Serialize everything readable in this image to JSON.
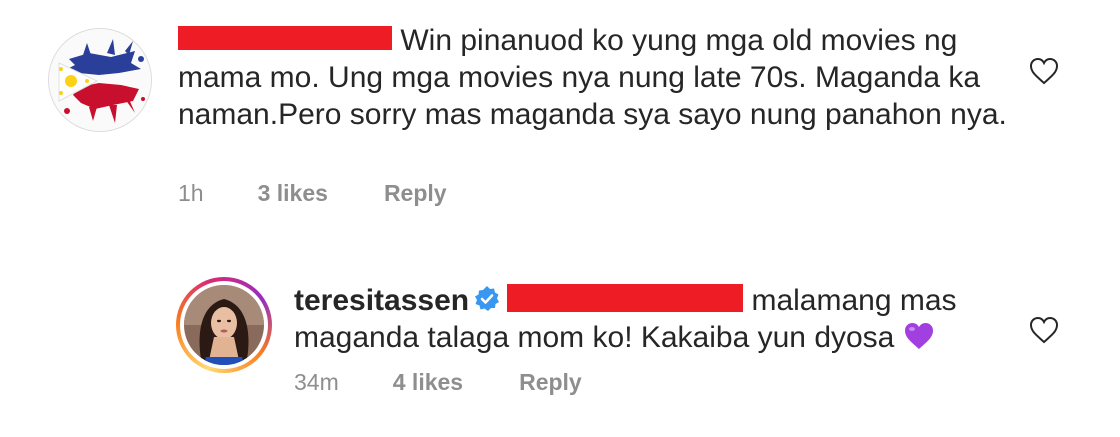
{
  "comments": [
    {
      "username": "",
      "mention": "",
      "text": "Win pinanuod ko yung mga old movies ng mama mo. Ung mga movies nya nung late 70s. Maganda ka naman.Pero sorry mas maganda sya sayo nung panahon nya.",
      "time": "1h",
      "likes": "3 likes",
      "reply_label": "Reply",
      "avatar_icon": "philippine-flag-splash-icon"
    },
    {
      "username": "teresitassen",
      "verified": true,
      "mention": "",
      "text": "malamang mas maganda talaga mom ko! Kakaiba yun dyosa",
      "emoji": "purple-heart-icon",
      "time": "34m",
      "likes": "4 likes",
      "reply_label": "Reply",
      "avatar_icon": "profile-photo-icon"
    }
  ],
  "colors": {
    "text": "#262626",
    "meta": "#8e8e8e",
    "redaction": "#ee1c25",
    "verified": "#3897f0",
    "emoji_purple": "#a23fe0"
  },
  "icons": {
    "like": "heart-outline-icon",
    "verified": "verified-badge-icon"
  }
}
